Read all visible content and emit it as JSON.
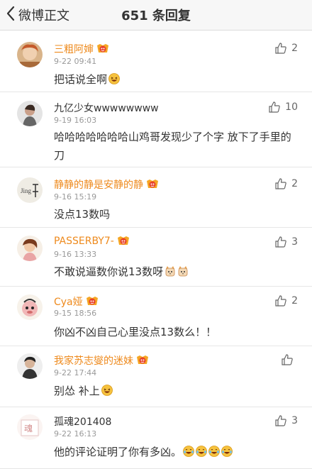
{
  "nav": {
    "back_label": "微博正文",
    "title": "651 条回复"
  },
  "comments": [
    {
      "user": "三粗阿婶",
      "time": "9-22 09:41",
      "text": "把话说全啊",
      "likes": "2",
      "name_color": "orange",
      "vip": true,
      "emojis": [
        "laugh-emoji"
      ]
    },
    {
      "user": "九亿少女wwwwwwww",
      "time": "9-19 16:03",
      "text": "哈哈哈哈哈哈哈山鸡哥发现少了个字 放下了手里的刀",
      "likes": "10",
      "name_color": "plain",
      "vip": false,
      "emojis": []
    },
    {
      "user": "静静的静是安静的静",
      "time": "9-16 15:19",
      "text": "没点13数吗",
      "likes": "2",
      "name_color": "orange",
      "vip": true,
      "emojis": []
    },
    {
      "user": "PASSERBY7-",
      "time": "9-16 13:33",
      "text": "不敢说逼数你说13数呀",
      "likes": "3",
      "name_color": "orange",
      "vip": true,
      "emojis": [
        "cat-emoji",
        "cat-emoji"
      ]
    },
    {
      "user": "Cya娅",
      "time": "9-15 18:56",
      "text": "你凶不凶自己心里没点13数么！！",
      "likes": "2",
      "name_color": "orange",
      "vip": true,
      "emojis": []
    },
    {
      "user": "我家苏志燮的迷妹",
      "time": "9-22 17:44",
      "text": "别怂 补上",
      "likes": "",
      "name_color": "orange",
      "vip": true,
      "emojis": [
        "laugh-emoji"
      ]
    },
    {
      "user": "孤魂201408",
      "time": "9-22 16:13",
      "text": "他的评论证明了你有多凶。",
      "likes": "3",
      "name_color": "plain",
      "vip": false,
      "emojis": [
        "laugh-cry-emoji",
        "laugh-cry-emoji",
        "laugh-cry-emoji",
        "laugh-cry-emoji"
      ]
    }
  ],
  "colors": {
    "name_vip": "#ee8a1d",
    "time": "#999999",
    "divider": "#e6e6e6"
  }
}
